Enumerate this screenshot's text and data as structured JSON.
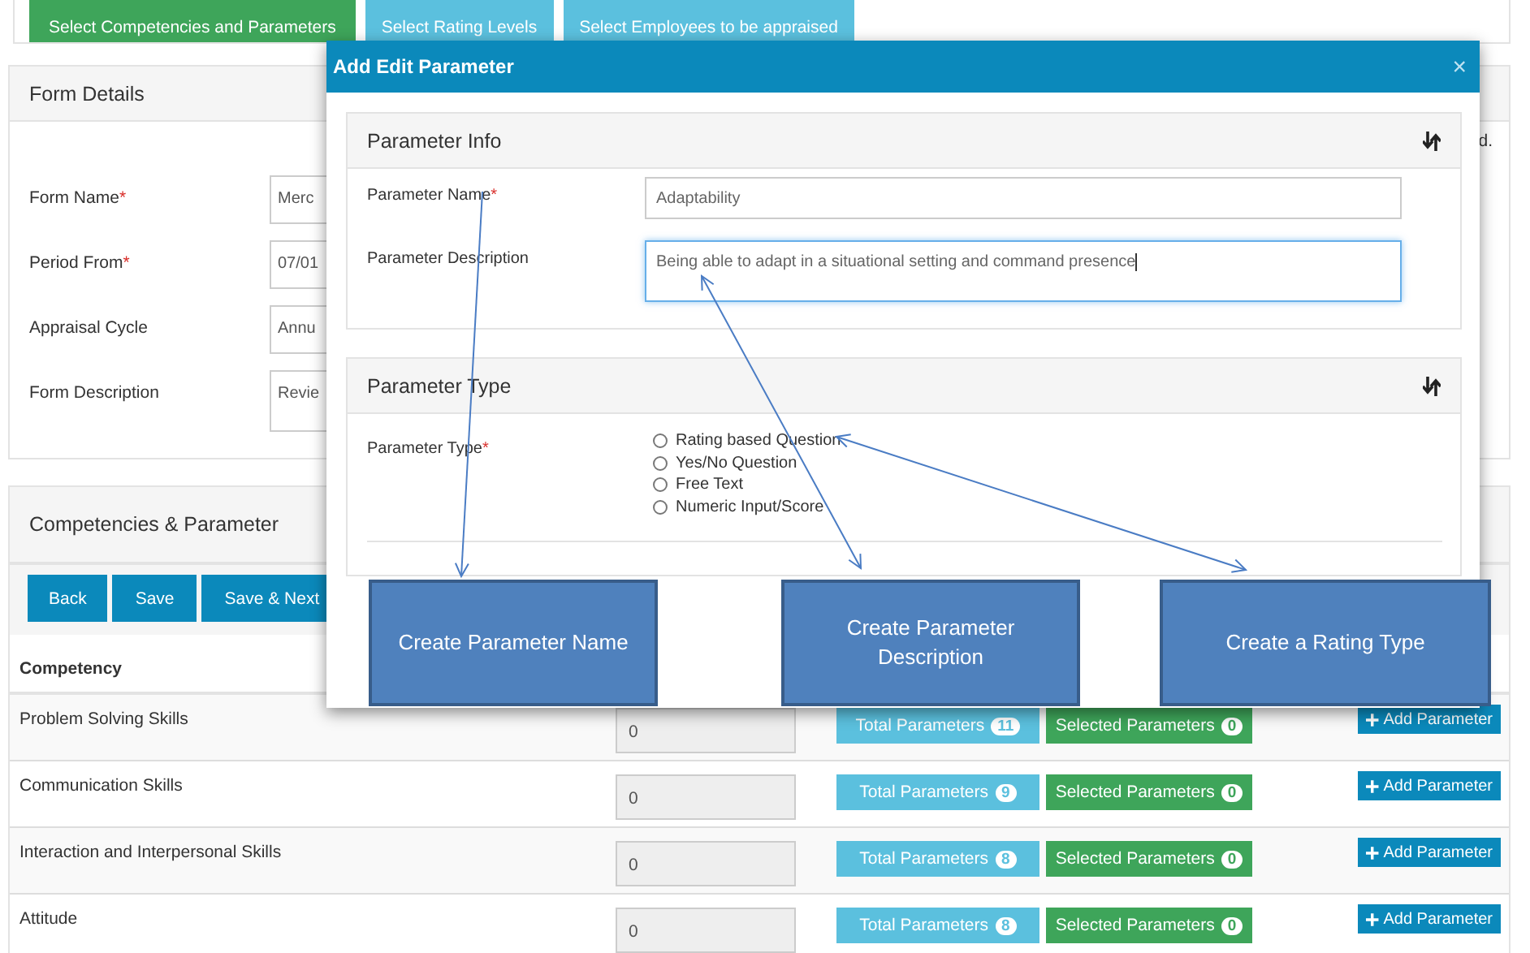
{
  "steps": [
    {
      "label": "Select Competencies and Parameters",
      "selected": true
    },
    {
      "label": "Select Rating Levels",
      "selected": false
    },
    {
      "label": "Select Employees to be appraised",
      "selected": false
    }
  ],
  "form_details": {
    "title": "Form Details",
    "note": "d.",
    "fields": [
      {
        "label": "Form Name",
        "required": "*",
        "value": "Merc",
        "kind": "input"
      },
      {
        "label": "Period From",
        "required": "*",
        "value": "07/01",
        "kind": "input"
      },
      {
        "label": "Appraisal Cycle",
        "value": "Annu",
        "kind": "input"
      },
      {
        "label": "Form Description",
        "value": "Revie",
        "kind": "textarea"
      }
    ]
  },
  "competencies": {
    "title": "Competencies & Parameter",
    "buttons": [
      "Back",
      "Save",
      "Save & Next"
    ],
    "column_1": "Competency",
    "rows": [
      {
        "name": "Problem Solving Skills",
        "value": "0",
        "total_label": "Total Parameters",
        "total": "11",
        "selected_label": "Selected Parameters",
        "selected_count": "0",
        "action": "Add Parameter"
      },
      {
        "name": "Communication Skills",
        "value": "0",
        "total_label": "Total Parameters",
        "total": "9",
        "selected_label": "Selected Parameters",
        "selected_count": "0",
        "action": "Add Parameter"
      },
      {
        "name": "Interaction and Interpersonal Skills",
        "value": "0",
        "total_label": "Total Parameters",
        "total": "8",
        "selected_label": "Selected Parameters",
        "selected_count": "0",
        "action": "Add Parameter"
      },
      {
        "name": "Attitude",
        "value": "0",
        "total_label": "Total Parameters",
        "total": "8",
        "selected_label": "Selected Parameters",
        "selected_count": "0",
        "action": "Add Parameter"
      }
    ]
  },
  "modal": {
    "title": "Add Edit Parameter",
    "close": "×",
    "parameter_info": {
      "title": "Parameter Info",
      "fields": [
        {
          "label": "Parameter Name",
          "required": "*",
          "value": "Adaptability",
          "kind": "input",
          "focused": false
        },
        {
          "label": "Parameter Description",
          "value": "Being able to adapt in a situational setting and command presence",
          "kind": "textarea",
          "focused": true
        }
      ]
    },
    "parameter_type": {
      "title": "Parameter Type",
      "label": "Parameter Type",
      "required": "*",
      "options": [
        {
          "label": "Rating based Question",
          "selected": false
        },
        {
          "label": "Yes/No Question",
          "selected": false
        },
        {
          "label": "Free Text",
          "selected": false
        },
        {
          "label": "Numeric Input/Score",
          "selected": false
        }
      ]
    }
  },
  "callouts": [
    {
      "text": "Create Parameter Name"
    },
    {
      "text": "Create Parameter Description"
    },
    {
      "text": "Create a Rating Type"
    }
  ]
}
